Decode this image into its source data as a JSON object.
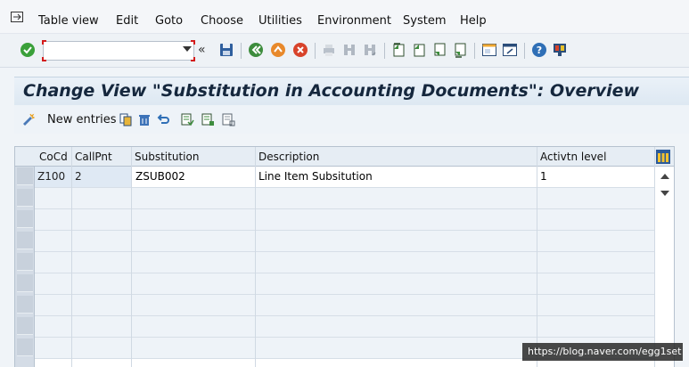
{
  "menu": {
    "items": [
      {
        "label": "Table view"
      },
      {
        "label": "Edit"
      },
      {
        "label": "Goto"
      },
      {
        "label": "Choose"
      },
      {
        "label": "Utilities"
      },
      {
        "label": "Environment"
      },
      {
        "label": "System"
      },
      {
        "label": "Help"
      }
    ]
  },
  "toolbar": {
    "command_field_value": "",
    "double_chevron": "«",
    "icons": [
      "enter-icon",
      "save-icon",
      "back-icon",
      "exit-icon",
      "cancel-icon",
      "print-icon",
      "find-icon",
      "find-next-icon",
      "first-page-icon",
      "previous-page-icon",
      "next-page-icon",
      "last-page-icon",
      "create-session-icon",
      "shortcut-icon",
      "help-icon",
      "customize-layout-icon"
    ]
  },
  "title": "Change View \"Substitution in Accounting Documents\": Overview",
  "app_toolbar": {
    "new_entries_label": "New entries"
  },
  "table": {
    "columns": [
      "CoCd",
      "CallPnt",
      "Substitution",
      "Description",
      "Activtn level"
    ],
    "rows": [
      [
        "Z100",
        "2",
        "ZSUB002",
        "Line Item Subsitution",
        "1"
      ]
    ]
  },
  "watermark": "https://blog.naver.com/egg1set",
  "colors": {
    "title_text": "#15273d",
    "command_field_marker": "#d31c1c",
    "enter_green": "#3aa03a"
  }
}
